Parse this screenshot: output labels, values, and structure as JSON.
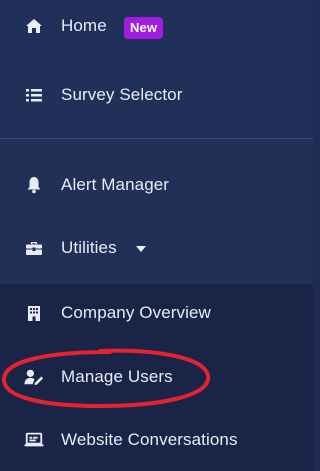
{
  "nav": {
    "home": {
      "label": "Home",
      "badge": "New",
      "icon": "home-icon"
    },
    "survey_selector": {
      "label": "Survey Selector",
      "icon": "list-icon"
    },
    "alert_manager": {
      "label": "Alert Manager",
      "icon": "bell-icon"
    },
    "utilities": {
      "label": "Utilities",
      "icon": "toolbox-icon",
      "expanded": true
    },
    "company_overview": {
      "label": "Company Overview",
      "icon": "building-icon"
    },
    "manage_users": {
      "label": "Manage Users",
      "icon": "user-edit-icon"
    },
    "website_conversations": {
      "label": "Website Conversations",
      "icon": "laptop-icon"
    }
  },
  "colors": {
    "sidebar_bg": "#202c55",
    "submenu_bg": "#1a2447",
    "badge_bg": "#a21be0",
    "highlight_annotation": "#e3232f"
  }
}
